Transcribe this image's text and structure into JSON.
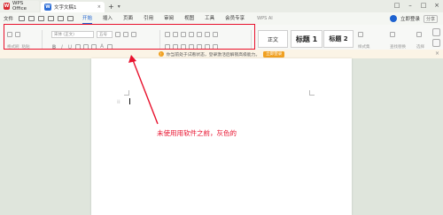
{
  "titlebar": {
    "tabs": [
      {
        "label": "WPS Office",
        "logo": "W",
        "color": "#d9272e"
      },
      {
        "label": "文字文稿1",
        "logo": "W",
        "color": "#2a6cd6"
      }
    ],
    "close_tab": "×",
    "add_tab": "+",
    "tab_menu": "▾",
    "window_controls": [
      "□",
      "–",
      "□",
      "×"
    ]
  },
  "menubar": {
    "file": "文件",
    "items": [
      "开始",
      "插入",
      "页面",
      "引用",
      "审阅",
      "视图",
      "工具",
      "会员专享"
    ],
    "active": "开始",
    "ai": "WPS AI",
    "login": "立即登录",
    "share": "分享"
  },
  "ribbon": {
    "paint_label": "格式刷",
    "paste_label": "粘贴",
    "font_name": "宋体 (正文)",
    "font_size": "五号",
    "styles": [
      {
        "label": "正文"
      },
      {
        "label": "标题 1"
      },
      {
        "label": "标题 2"
      }
    ],
    "find_label": "查找替换",
    "select_label": "选择",
    "format_label": "样式集"
  },
  "notice": {
    "text": "你当前处于试看状态，登录激活后解锁高级能力。",
    "button": "立即登录",
    "close": "×"
  },
  "annotation": {
    "text": "未使用用软件之前，灰色的",
    "color": "#e8112d"
  },
  "colors": {
    "accent": "#1e62d0",
    "highlight": "#e8112d",
    "warning": "#f0a020"
  }
}
